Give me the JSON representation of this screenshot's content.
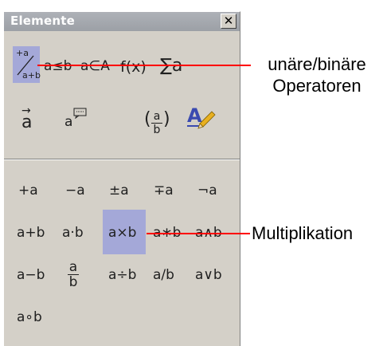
{
  "panel": {
    "title": "Elemente",
    "close_glyph": "✕"
  },
  "categories": [
    {
      "name": "unary-binary",
      "label": "+a/a+b",
      "selected": true
    },
    {
      "name": "relations",
      "label": "a≤b"
    },
    {
      "name": "set-operations",
      "label": "a∈A"
    },
    {
      "name": "functions",
      "label": "f(x)"
    },
    {
      "name": "operators",
      "label": "Σa"
    },
    {
      "name": "attributes",
      "label": "a⃗"
    },
    {
      "name": "others",
      "label": "a💬"
    },
    {
      "name": "brackets",
      "label": "(a/b)"
    },
    {
      "name": "formats",
      "label": "A"
    }
  ],
  "ops_row1": [
    "+a",
    "−a",
    "±a",
    "∓a",
    "¬a"
  ],
  "ops_row2": [
    "a+b",
    "a·b",
    "a×b",
    "a∗b",
    "a∧b"
  ],
  "ops_row3": [
    "a−b",
    "a/b frac",
    "a÷b",
    "a/b",
    "a∨b"
  ],
  "ops_row4": [
    "a∘b"
  ],
  "cat_sym": {
    "unary_top": "+a",
    "unary_bottom": "a+b",
    "rel": "a≤b",
    "set": "a∈A",
    "func": "f(x)",
    "sum": "∑a",
    "vec": "a",
    "vec_arrow": "→",
    "other": "a",
    "bracket_a": "a",
    "bracket_b": "b",
    "format": "A"
  },
  "frac_a": "a",
  "frac_b": "b",
  "row1": [
    "+a",
    "−a",
    "±a",
    "∓a",
    "¬a"
  ],
  "row2": [
    "a+b",
    "a·b",
    "a×b",
    "a∗b",
    "a∧b"
  ],
  "row3": [
    "a−b",
    "a÷b",
    "a/b",
    "a∨b"
  ],
  "row4": [
    "a∘b"
  ],
  "annotations": {
    "top_line1": "unäre/binäre",
    "top_line2": "Operatoren",
    "bottom": "Multiplikation"
  },
  "colors": {
    "selection": "#a4a8d8",
    "callout_line": "#ff0000"
  }
}
